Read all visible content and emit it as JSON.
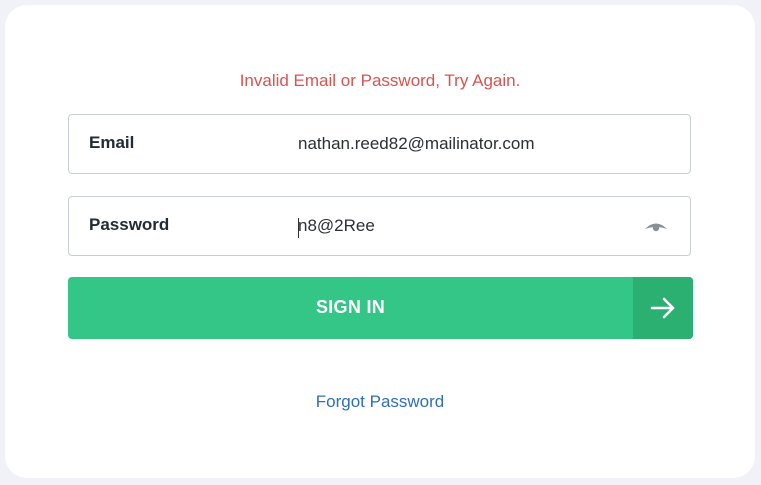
{
  "login": {
    "error_message": "Invalid Email or Password, Try Again.",
    "email": {
      "label": "Email",
      "value": "nathan.reed82@mailinator.com"
    },
    "password": {
      "label": "Password",
      "value": "n8@2Ree",
      "toggle_icon": "eye-icon"
    },
    "signin": {
      "label": "SIGN IN",
      "icon": "arrow-right-icon"
    },
    "forgot_password": "Forgot Password"
  },
  "colors": {
    "error": "#d9534f",
    "primary_button": "#34c686",
    "primary_button_dark": "#2bb072",
    "link": "#2f6fb6"
  }
}
